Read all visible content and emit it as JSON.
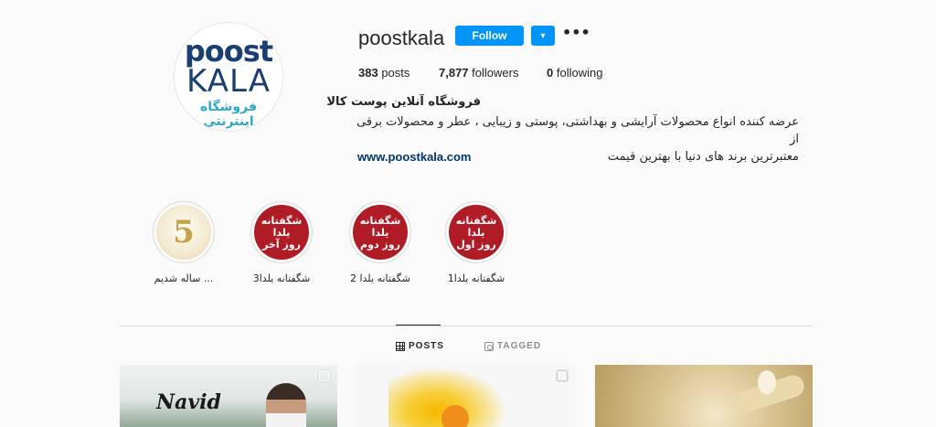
{
  "profile": {
    "logo_line1": "poost",
    "logo_line2": "KALA",
    "logo_line3": "فروشگاه اینترنتی",
    "username": "poostkala",
    "follow_label": "Follow",
    "dropdown_glyph": "▾",
    "more_glyph": "•••",
    "stats": {
      "posts_count": "383",
      "posts_label": "posts",
      "followers_count": "7,877",
      "followers_label": "followers",
      "following_count": "0",
      "following_label": "following"
    },
    "full_name": "فروشگاه آنلاین پوست کالا",
    "bio_line1": "عرضه کننده انواع محصولات آرایشی و بهداشتی، پوستی و زیبایی ، عطر و محصولات برقی از",
    "bio_line2": "معتبرترین برند های دنیا با بهترین قیمت",
    "website": "www.poostkala.com",
    "accent_color": "#0095f6"
  },
  "highlights": [
    {
      "label": "... ساله شدیم",
      "cover_line1": "",
      "cover_line2": "",
      "cover_line3": "",
      "cover_number": "5"
    },
    {
      "label": "شگفتانه یلدا3",
      "cover_line1": "شگفتانه",
      "cover_line2": "یلدا",
      "cover_line3": "روز آخر",
      "cover_number": ""
    },
    {
      "label": "شگفتانه یلدا 2",
      "cover_line1": "شگفتانه",
      "cover_line2": "یلدا",
      "cover_line3": "روز دوم",
      "cover_number": ""
    },
    {
      "label": "شگفتانه یلدا1",
      "cover_line1": "شگفتانه",
      "cover_line2": "یلدا",
      "cover_line3": "روز اول",
      "cover_number": ""
    }
  ],
  "tabs": {
    "posts_label": "POSTS",
    "tagged_label": "TAGGED"
  },
  "posts": {
    "post1_text": "Navid"
  }
}
